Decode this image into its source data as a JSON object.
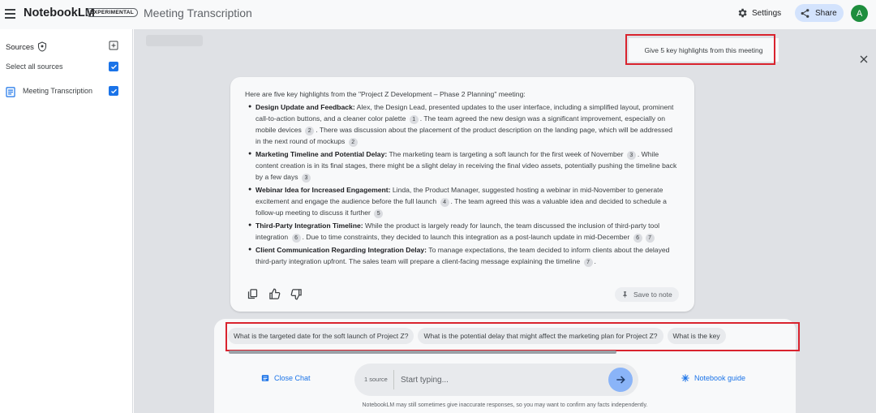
{
  "header": {
    "logo": "NotebookLM",
    "badge": "EXPERIMENTAL",
    "title": "Meeting Transcription",
    "settings_label": "Settings",
    "share_label": "Share",
    "avatar_initial": "A"
  },
  "sidebar": {
    "sources_label": "Sources",
    "select_all_label": "Select all sources",
    "sources": [
      {
        "label": "Meeting Transcription",
        "checked": true
      }
    ]
  },
  "chat": {
    "user_message": "Give 5 key highlights from this meeting",
    "response_intro": "Here are five key highlights from the \"Project Z Development – Phase 2 Planning\" meeting:",
    "highlights": [
      {
        "title": "Design Update and Feedback:",
        "parts": [
          " Alex, the Design Lead, presented updates to the user interface, including a simplified layout, prominent call-to-action buttons, and a cleaner color palette ",
          "1",
          ". The team agreed the new design was a significant improvement, especially on mobile devices ",
          "2",
          ". There was discussion about the placement of the product description on the landing page, which will be addressed in the next round of mockups ",
          "2"
        ]
      },
      {
        "title": "Marketing Timeline and Potential Delay:",
        "parts": [
          " The marketing team is targeting a soft launch for the first week of November ",
          "3",
          ". While content creation is in its final stages, there might be a slight delay in receiving the final video assets, potentially pushing the timeline back by a few days ",
          "3"
        ]
      },
      {
        "title": "Webinar Idea for Increased Engagement:",
        "parts": [
          " Linda, the Product Manager, suggested hosting a webinar in mid-November to generate excitement and engage the audience before the full launch ",
          "4",
          ". The team agreed this was a valuable idea and decided to schedule a follow-up meeting to discuss it further ",
          "5"
        ]
      },
      {
        "title": "Third-Party Integration Timeline:",
        "parts": [
          " While the product is largely ready for launch, the team discussed the inclusion of third-party tool integration ",
          "6",
          ". Due to time constraints, they decided to launch this integration as a post-launch update in mid-December ",
          "6",
          "",
          "7"
        ]
      },
      {
        "title": "Client Communication Regarding Integration Delay:",
        "parts": [
          " To manage expectations, the team decided to inform clients about the delayed third-party integration upfront. The sales team will prepare a client-facing message explaining the timeline ",
          "7",
          "."
        ]
      }
    ],
    "save_to_note_label": "Save to note",
    "suggestions": [
      "What is the targeted date for the soft launch of Project Z?",
      "What is the potential delay that might affect the marketing plan for Project Z?",
      "What is the key"
    ],
    "close_chat_label": "Close Chat",
    "source_count": "1 source",
    "input_placeholder": "Start typing...",
    "notebook_guide_label": "Notebook guide",
    "disclaimer": "NotebookLM may still sometimes give inaccurate responses, so you may want to confirm any facts independently."
  },
  "colors": {
    "accent": "#1a73e8",
    "highlight_box": "#d9232e",
    "avatar": "#1e8e3e"
  }
}
